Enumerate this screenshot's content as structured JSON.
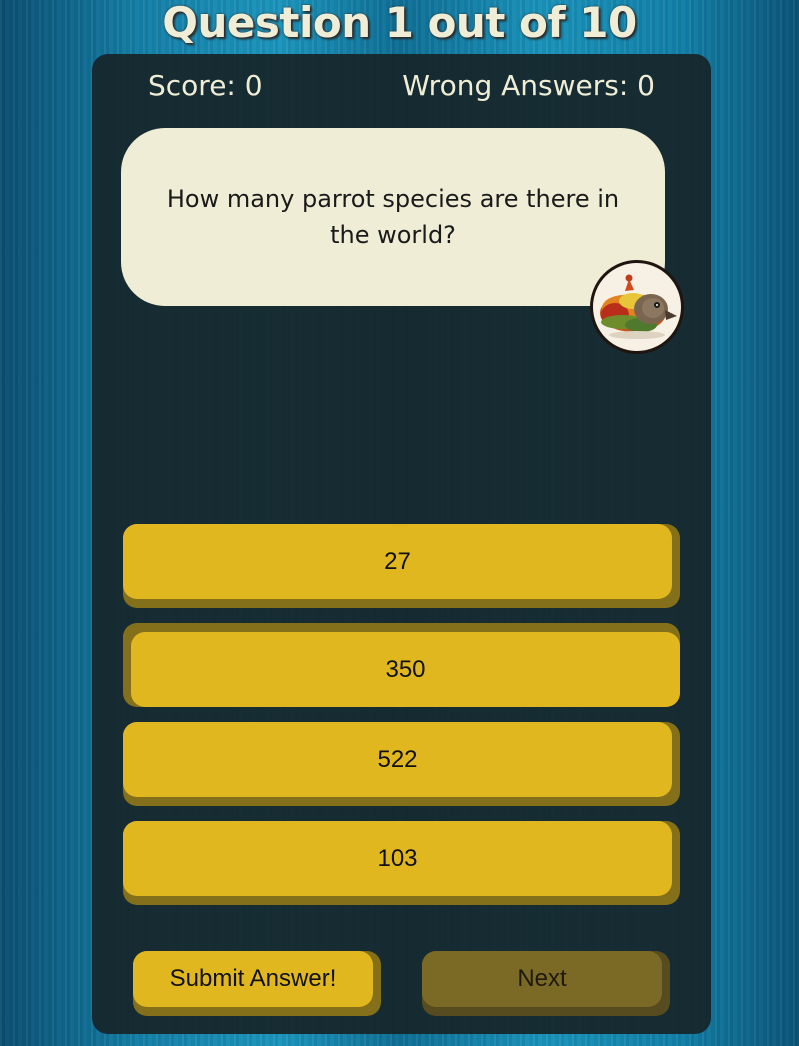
{
  "header": {
    "title": "Question 1 out of 10"
  },
  "stats": {
    "score": "Score: 0",
    "wrong": "Wrong Answers: 0"
  },
  "question": {
    "text": "How many parrot species are there in the world?",
    "avatar_icon": "parrot-avatar-icon"
  },
  "answers": [
    {
      "label": "27",
      "selected": false
    },
    {
      "label": "350",
      "selected": true
    },
    {
      "label": "522",
      "selected": false
    },
    {
      "label": "103",
      "selected": false
    }
  ],
  "actions": {
    "submit_label": "Submit Answer!",
    "next_label": "Next",
    "next_enabled": false
  },
  "colors": {
    "accent": "#e1b720",
    "accent_shadow": "#84701a",
    "panel": "#16262a",
    "bubble": "#efedd6",
    "background": "#1580a8",
    "disabled": "#7a6a26"
  }
}
